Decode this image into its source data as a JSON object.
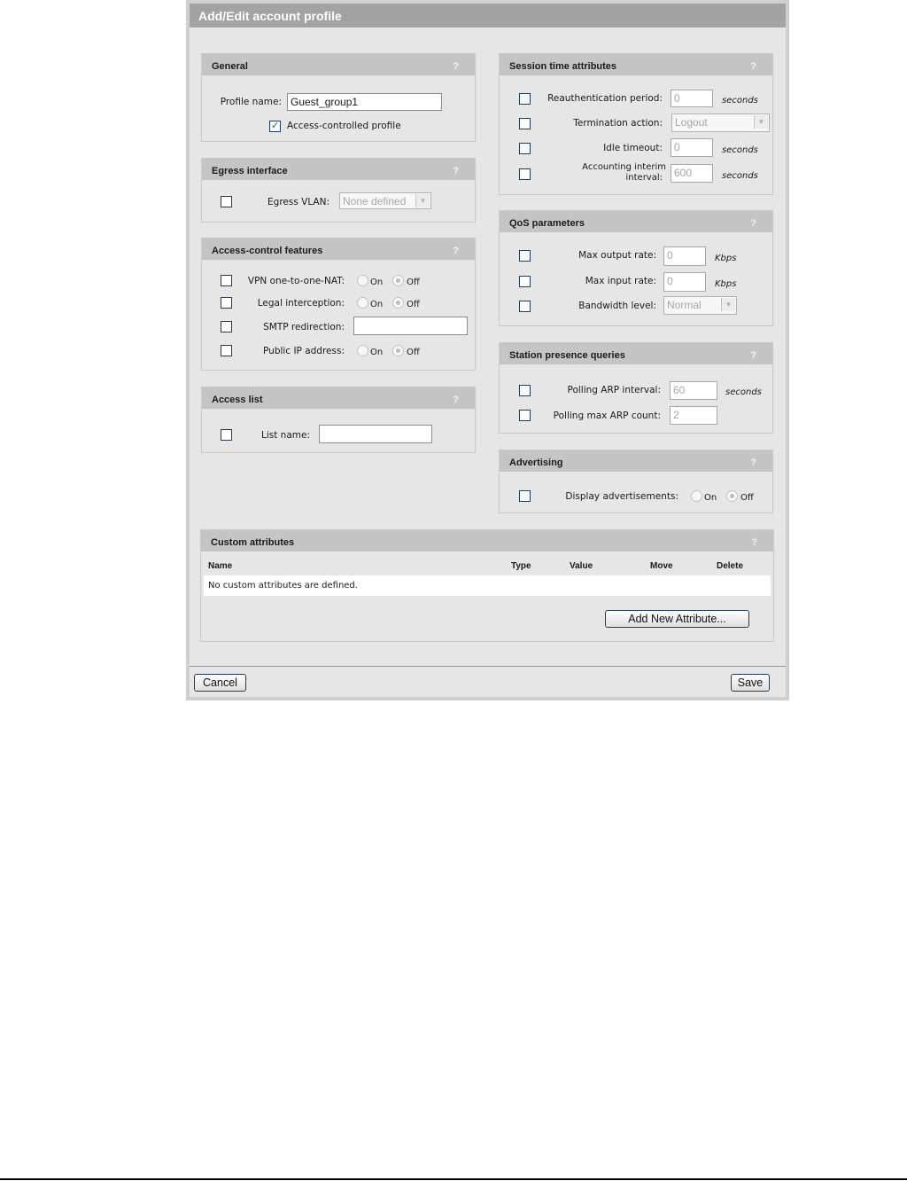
{
  "dialog": {
    "title": "Add/Edit account profile",
    "help_glyph": "?"
  },
  "general": {
    "title": "General",
    "profile_name_label": "Profile name:",
    "profile_name_value": "Guest_group1",
    "access_controlled_label": "Access-controlled profile",
    "access_controlled_checked": true
  },
  "egress": {
    "title": "Egress interface",
    "vlan_label": "Egress VLAN:",
    "vlan_value": "None defined"
  },
  "access_control": {
    "title": "Access-control features",
    "vpn_label": "VPN one-to-one-NAT:",
    "legal_label": "Legal interception:",
    "smtp_label": "SMTP redirection:",
    "smtp_value": "",
    "public_ip_label": "Public IP address:",
    "on": "On",
    "off": "Off"
  },
  "access_list": {
    "title": "Access list",
    "list_name_label": "List name:",
    "list_name_value": ""
  },
  "session": {
    "title": "Session time attributes",
    "reauth_label": "Reauthentication period:",
    "reauth_value": "0",
    "termination_label": "Termination action:",
    "termination_value": "Logout",
    "idle_label": "Idle timeout:",
    "idle_value": "0",
    "acct_label_1": "Accounting interim",
    "acct_label_2": "interval:",
    "acct_value": "600",
    "seconds": "seconds"
  },
  "qos": {
    "title": "QoS parameters",
    "max_output_label": "Max output rate:",
    "max_output_value": "0",
    "max_input_label": "Max input rate:",
    "max_input_value": "0",
    "bandwidth_label": "Bandwidth level:",
    "bandwidth_value": "Normal",
    "kbps": "Kbps"
  },
  "station": {
    "title": "Station presence queries",
    "arp_interval_label": "Polling ARP interval:",
    "arp_interval_value": "60",
    "arp_count_label": "Polling max ARP count:",
    "arp_count_value": "2",
    "seconds": "seconds"
  },
  "advertising": {
    "title": "Advertising",
    "display_label": "Display advertisements:",
    "on": "On",
    "off": "Off"
  },
  "custom": {
    "title": "Custom attributes",
    "columns": [
      "Name",
      "Type",
      "Value",
      "Move",
      "Delete"
    ],
    "empty_message": "No custom attributes are defined.",
    "add_button": "Add New Attribute..."
  },
  "footer": {
    "cancel": "Cancel",
    "save": "Save"
  }
}
